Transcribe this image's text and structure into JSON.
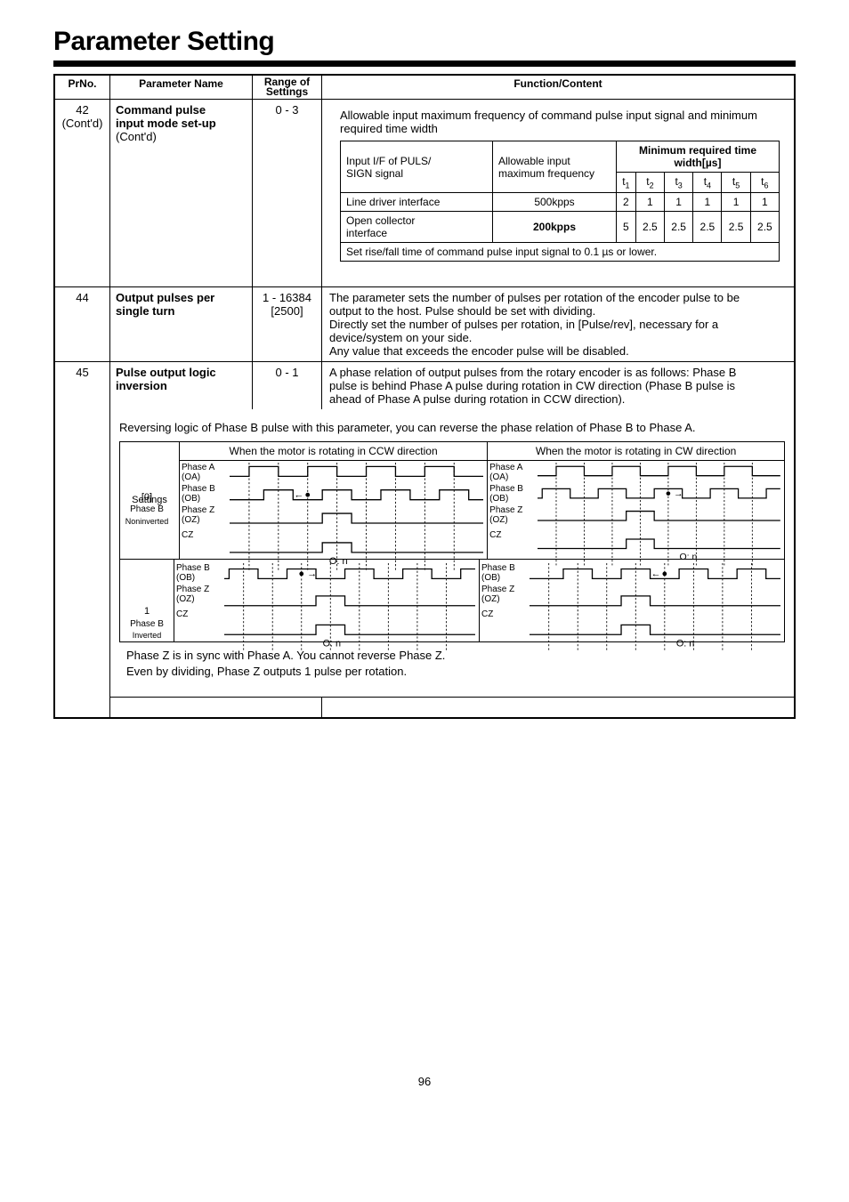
{
  "page_title": "Parameter Setting",
  "page_number": "96",
  "headers": {
    "prno": "PrNo.",
    "param_name": "Parameter Name",
    "range": "Range of Settings",
    "function": "Function/Content"
  },
  "row42": {
    "prno": "42",
    "prno_cont": "(Cont'd)",
    "name_line1": "Command pulse",
    "name_line2": "input mode set-up",
    "name_cont": "(Cont'd)",
    "range": "0 - 3",
    "intro": "Allowable input maximum frequency of command pulse input signal and minimum required time width",
    "th_iface1": "Input I/F of PULS/",
    "th_iface2": "SIGN signal",
    "th_allow1": "Allowable input",
    "th_allow2": "maximum frequency",
    "th_min": "Minimum required time width[µs]",
    "t_labels": [
      "t",
      "t",
      "t",
      "t",
      "t",
      "t"
    ],
    "t_subs": [
      "1",
      "2",
      "3",
      "4",
      "5",
      "6"
    ],
    "row_line": {
      "iface": "Line driver interface",
      "freq": "500kpps",
      "vals": [
        "2",
        "1",
        "1",
        "1",
        "1",
        "1"
      ]
    },
    "row_oc": {
      "iface1": "Open collector",
      "iface2": "interface",
      "freq": "200kpps",
      "vals": [
        "5",
        "2.5",
        "2.5",
        "2.5",
        "2.5",
        "2.5"
      ]
    },
    "note": "Set rise/fall time of command pulse input signal to 0.1 µs or lower."
  },
  "row44": {
    "prno": "44",
    "name_line1": "Output pulses per",
    "name_line2": "single turn",
    "range1": "1 - 16384",
    "range2": "[2500]",
    "desc": [
      "The parameter sets the number of pulses per rotation of the encoder pulse to be",
      "output to the host.  Pulse should be set with dividing.",
      "Directly set the number of pulses per rotation, in [Pulse/rev], necessary for a",
      "device/system on your side.",
      "Any value that exceeds the encoder pulse will be disabled."
    ]
  },
  "row45": {
    "prno": "45",
    "name_line1": "Pulse output logic",
    "name_line2": "inversion",
    "range": "0 - 1",
    "desc": [
      "A phase relation of output pulses from the rotary encoder is as follows: Phase B",
      "pulse is behind Phase A pulse during rotation in CW direction (Phase B pulse is",
      "ahead of Phase A pulse during rotation in CCW direction)."
    ],
    "reverse_note": "Reversing logic of Phase B pulse with this parameter, you can reverse the phase relation of Phase B to Phase A.",
    "settings_hdr": "Settings",
    "ccw_hdr": "When the motor is rotating in CCW direction",
    "cw_hdr": "When the motor is rotating in CW direction",
    "sig_labels": {
      "A1": "Phase A",
      "A2": "(OA)",
      "B1": "Phase B",
      "B2": "(OB)",
      "Z1": "Phase Z",
      "Z2": "(OZ)",
      "CZ": "CZ",
      "On": "O: n"
    },
    "set0": {
      "id": "[0]",
      "l2": "Phase B",
      "l3": "Noninverted"
    },
    "set1": {
      "id": "1",
      "l2": "Phase B",
      "l3": "Inverted"
    },
    "foot1": "Phase Z is in sync with Phase A.  You cannot reverse Phase Z.",
    "foot2": "Even by dividing, Phase Z outputs 1 pulse per rotation."
  },
  "chart_data": {
    "type": "table",
    "title": "Allowable input maximum frequency / minimum required time width",
    "columns": [
      "Interface",
      "Max frequency (kpps)",
      "t1 (µs)",
      "t2 (µs)",
      "t3 (µs)",
      "t4 (µs)",
      "t5 (µs)",
      "t6 (µs)"
    ],
    "rows": [
      [
        "Line driver interface",
        500,
        2,
        1,
        1,
        1,
        1,
        1
      ],
      [
        "Open collector interface",
        200,
        5,
        2.5,
        2.5,
        2.5,
        2.5,
        2.5
      ]
    ]
  }
}
